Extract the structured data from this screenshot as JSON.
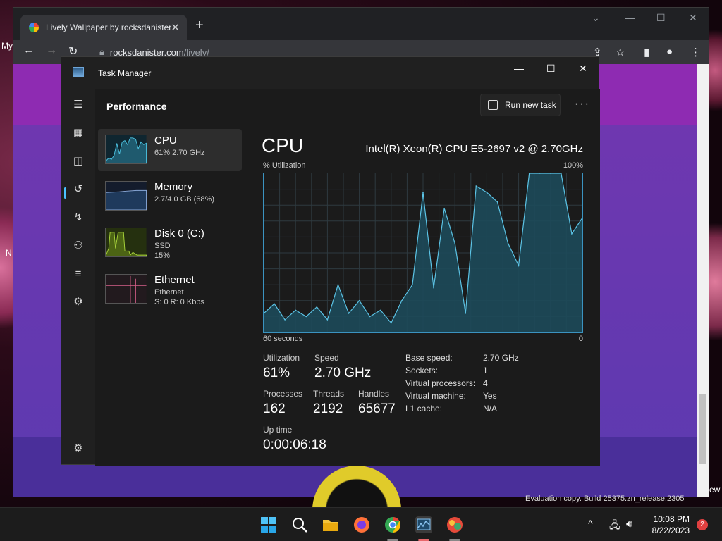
{
  "desktop": {
    "label_my": "My",
    "label_n": "N",
    "label_ew": "ew"
  },
  "browser": {
    "tab_title": "Lively Wallpaper by rocksdanister",
    "url_host": "rocksdanister.com",
    "url_path": "/lively/",
    "watermark": "Evaluation copy. Build 25375.zn_release.2305"
  },
  "taskmanager": {
    "title": "Task Manager",
    "page_title": "Performance",
    "run_task_label": "Run new task",
    "devices": [
      {
        "name": "CPU",
        "sub1": "61% 2.70 GHz",
        "sub2": ""
      },
      {
        "name": "Memory",
        "sub1": "2.7/4.0 GB (68%)",
        "sub2": ""
      },
      {
        "name": "Disk 0 (C:)",
        "sub1": "SSD",
        "sub2": "15%"
      },
      {
        "name": "Ethernet",
        "sub1": "Ethernet",
        "sub2": "S: 0 R: 0 Kbps"
      }
    ],
    "detail": {
      "heading": "CPU",
      "model": "Intel(R) Xeon(R) CPU E5-2697 v2 @ 2.70GHz",
      "y_label": "% Utilization",
      "y_max_label": "100%",
      "x_left_label": "60 seconds",
      "x_right_label": "0",
      "utilization_label": "Utilization",
      "utilization": "61%",
      "speed_label": "Speed",
      "speed": "2.70 GHz",
      "processes_label": "Processes",
      "processes": "162",
      "threads_label": "Threads",
      "threads": "2192",
      "handles_label": "Handles",
      "handles": "65677",
      "uptime_label": "Up time",
      "uptime": "0:00:06:18",
      "specs": [
        {
          "k": "Base speed:",
          "v": "2.70 GHz"
        },
        {
          "k": "Sockets:",
          "v": "1"
        },
        {
          "k": "Virtual processors:",
          "v": "4"
        },
        {
          "k": "Virtual machine:",
          "v": "Yes"
        },
        {
          "k": "L1 cache:",
          "v": "N/A"
        }
      ]
    }
  },
  "chart_data": {
    "type": "area",
    "title": "CPU",
    "ylabel": "% Utilization",
    "ylim": [
      0,
      100
    ],
    "x": [
      60,
      58,
      56,
      54,
      52,
      50,
      48,
      46,
      44,
      42,
      40,
      38,
      36,
      34,
      32,
      30,
      28,
      26,
      24,
      22,
      20,
      18,
      16,
      14,
      12,
      10,
      8,
      6,
      4,
      2,
      0
    ],
    "series": [
      {
        "values": [
          12,
          18,
          8,
          14,
          10,
          16,
          8,
          30,
          12,
          20,
          10,
          14,
          6,
          20,
          30,
          88,
          28,
          78,
          56,
          12,
          92,
          88,
          82,
          56,
          42,
          100,
          100,
          100,
          100,
          62,
          72
        ]
      }
    ]
  },
  "taskbar": {
    "time": "10:08 PM",
    "date": "8/22/2023",
    "notifications": "2"
  }
}
